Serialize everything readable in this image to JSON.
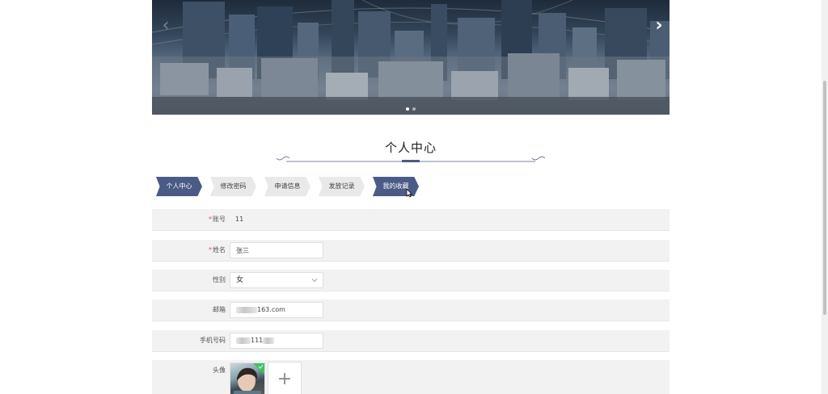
{
  "banner": {
    "prev_icon": "‹",
    "next_icon": "›",
    "slides": [
      1,
      2
    ],
    "active_slide": 1
  },
  "section": {
    "title": "个人中心"
  },
  "tabs": [
    {
      "label": "个人中心",
      "active": true
    },
    {
      "label": "修改密码",
      "active": false
    },
    {
      "label": "申请信息",
      "active": false
    },
    {
      "label": "发放记录",
      "active": false
    },
    {
      "label": "我的收藏",
      "active": true
    }
  ],
  "form": {
    "account": {
      "label": "账号",
      "required_mark": "*",
      "value": "11"
    },
    "name": {
      "label": "姓名",
      "required_mark": "*",
      "value": "张三"
    },
    "gender": {
      "label": "性别",
      "value": "女"
    },
    "email": {
      "label": "邮箱",
      "value_suffix": "163.com"
    },
    "phone": {
      "label": "手机号码",
      "value_middle": "111"
    },
    "avatar": {
      "label": "头像",
      "upload_icon": "+"
    }
  },
  "colors": {
    "accent": "#4a5b86",
    "tab_inactive": "#e9e9ea",
    "row_bg": "#f2f2f2",
    "required": "#e04a4a",
    "check": "#3cc35a"
  }
}
